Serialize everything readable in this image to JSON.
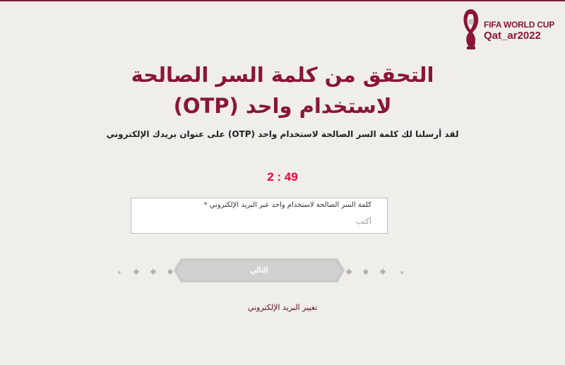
{
  "brand": {
    "line1": "FIFA WORLD CUP",
    "line2": "Qat_ar2022",
    "accent": "#8a1538"
  },
  "page": {
    "title_line1": "التحقق من كلمة السر الصالحة",
    "title_line2": "لاستخدام واحد (OTP)",
    "subtitle": "لقد أرسلنا لك كلمة السر الصالحة لاستخدام واحد (OTP) على عنوان بريدك الإلكتروني",
    "timer": "2 : 49",
    "timer_color": "#e8003d"
  },
  "otp_field": {
    "label": "كلمة السر الصالحة لاستخدام واحد عبر البريد الإلكتروني *",
    "placeholder": "أكتب",
    "value": ""
  },
  "actions": {
    "next_label": "التالي",
    "next_state": "disabled",
    "change_email_label": "تغيير البريد الإلكتروني"
  },
  "icons": {
    "logo": "world-cup-trophy-icon",
    "decor": "diamond-dot-icon"
  }
}
